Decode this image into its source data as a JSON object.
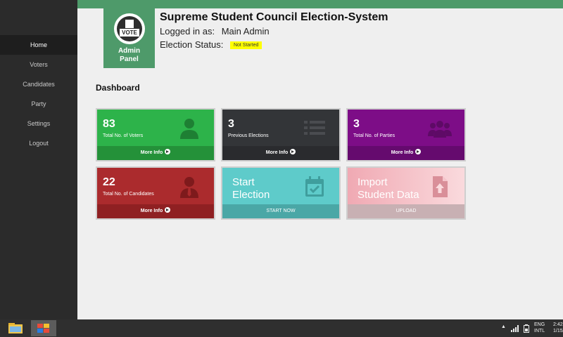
{
  "sidebar": {
    "items": [
      {
        "label": "Home",
        "active": true
      },
      {
        "label": "Voters"
      },
      {
        "label": "Candidates"
      },
      {
        "label": "Party"
      },
      {
        "label": "Settings"
      },
      {
        "label": "Logout"
      }
    ]
  },
  "header": {
    "badge_top": "VOTE",
    "badge_line1": "Admin",
    "badge_line2": "Panel",
    "title": "Supreme Student Council Election-System",
    "logged_in_label": "Logged in as:",
    "logged_in_user": "Main Admin",
    "status_label": "Election Status:",
    "status_value": "Not Started"
  },
  "dashboard": {
    "title": "Dashboard",
    "cards": [
      {
        "number": "83",
        "label": "Total No. of Voters",
        "footer": "More Info",
        "color": "#2db34a",
        "footer_color": "#249139"
      },
      {
        "number": "3",
        "label": "Previous Elections",
        "footer": "More Info",
        "color": "#333538",
        "footer_color": "#2a2b2e"
      },
      {
        "number": "3",
        "label": "Total No. of Parties",
        "footer": "More Info",
        "color": "#7d0d87",
        "footer_color": "#650a6e"
      },
      {
        "number": "22",
        "label": "Total No. of Candidates",
        "footer": "More Info",
        "color": "#ab2b2d",
        "footer_color": "#8f2022"
      },
      {
        "line1": "Start",
        "line2": "Election",
        "footer": "START NOW",
        "color": "#5ecbca",
        "footer_color": "#4aa7a6"
      },
      {
        "line1": "Import",
        "line2": "Student Data",
        "footer": "UPLOAD",
        "color": "#f2b3bb",
        "footer_color": "#c8b0b3"
      }
    ]
  },
  "taskbar": {
    "lang": "ENG",
    "layout": "INTL",
    "time": "2:42",
    "date": "1/15/"
  },
  "icons": {
    "voters": "user-icon",
    "elections": "list-icon",
    "parties": "group-icon",
    "candidates": "person-tie-icon",
    "start": "calendar-check-icon",
    "import": "file-upload-icon"
  }
}
